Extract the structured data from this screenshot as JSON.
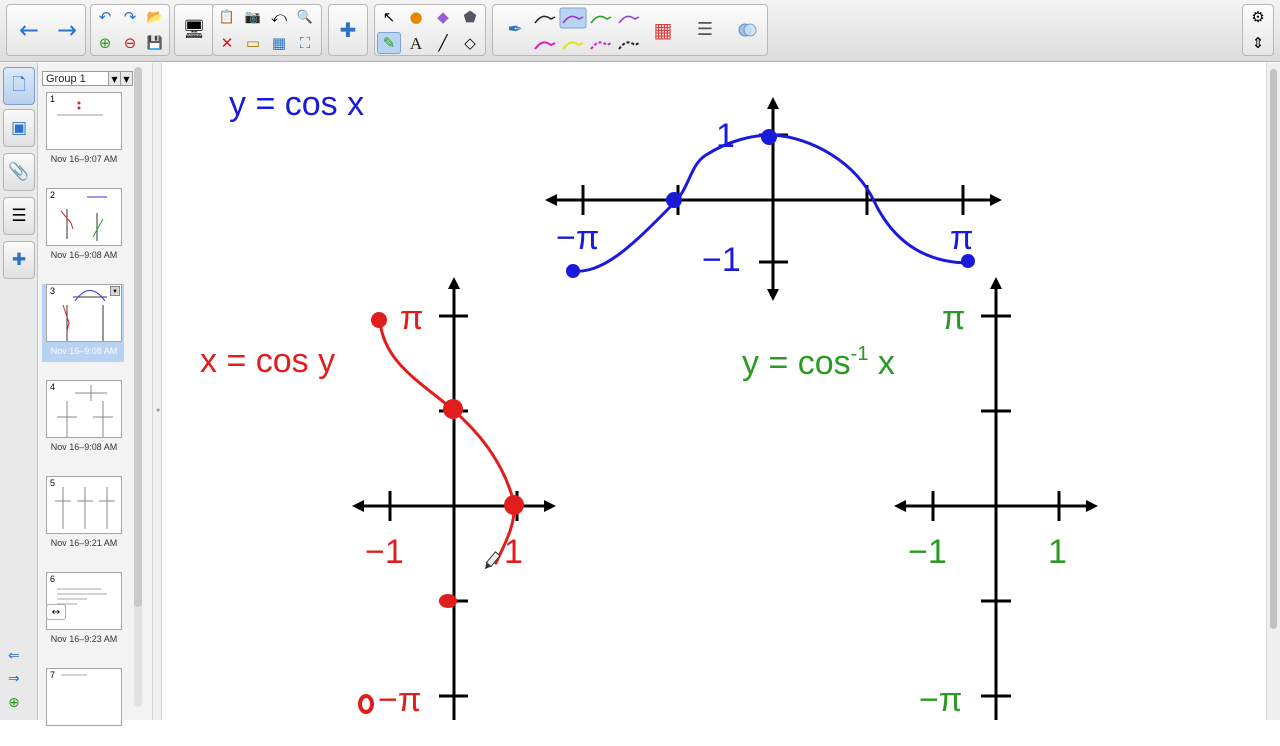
{
  "toolbar": {
    "icons": {
      "back": "←",
      "forward": "→",
      "undo": "↶",
      "redo": "↷",
      "open": "📂",
      "add_page": "⊕",
      "delete_page": "⊖",
      "save": "💾",
      "screen": "🖥",
      "paste": "📋",
      "screenshot": "📷",
      "shade": "⤺",
      "magic": "🔍",
      "delete": "✕",
      "screen_shade": "▭",
      "table": "▦",
      "fullscreen": "⛶",
      "addons": "✚",
      "select": "↖",
      "shapes": "●",
      "eraser": "◆",
      "fill": "⬟",
      "pens": "✎",
      "text": "A",
      "line": "╱",
      "eraser2": "◇",
      "pen": "✒",
      "palette": "▦",
      "properties": "☰",
      "settings": "⚙",
      "dual": "⇕"
    },
    "colors": {
      "accent": "#2b72c9"
    }
  },
  "side_tabs": {
    "pages_icon": "🗋",
    "gallery_icon": "▣",
    "attachments_icon": "📎",
    "properties_icon": "☰",
    "addons_icon": "✚",
    "nav_prev": "⇐",
    "nav_next": "⇒",
    "nav_add": "⊕"
  },
  "sorter": {
    "group": "Group 1",
    "dropdown": "▼",
    "expand": "↔",
    "thumbnails": [
      {
        "num": "1",
        "caption": "Nov 16–9:07 AM"
      },
      {
        "num": "2",
        "caption": "Nov 16–9:08 AM"
      },
      {
        "num": "3",
        "caption": "Nov 16–9:08 AM"
      },
      {
        "num": "4",
        "caption": "Nov 16–9:08 AM"
      },
      {
        "num": "5",
        "caption": "Nov 16–9:21 AM"
      },
      {
        "num": "6",
        "caption": "Nov 16–9:23 AM"
      },
      {
        "num": "7",
        "caption": ""
      }
    ]
  },
  "canvas": {
    "cos_title": "y = cos x",
    "cos_label_1": "1",
    "cos_label_neg1": "−1",
    "cos_label_negpi": "−π",
    "cos_label_pi": "π",
    "xcosy_title": "x = cos y",
    "xcosy_pi": "π",
    "xcosy_neg1": "−1",
    "xcosy_1": "1",
    "xcosy_negpi": "−π",
    "arccos_title_main": "y = cos",
    "arccos_title_sup": "-1",
    "arccos_title_x": "x",
    "arccos_pi": "π",
    "arccos_neg1": "−1",
    "arccos_1": "1",
    "arccos_negpi": "−π",
    "colors": {
      "blue": "#1a1adb",
      "red": "#e11d1d",
      "green": "#2a9a22"
    }
  }
}
